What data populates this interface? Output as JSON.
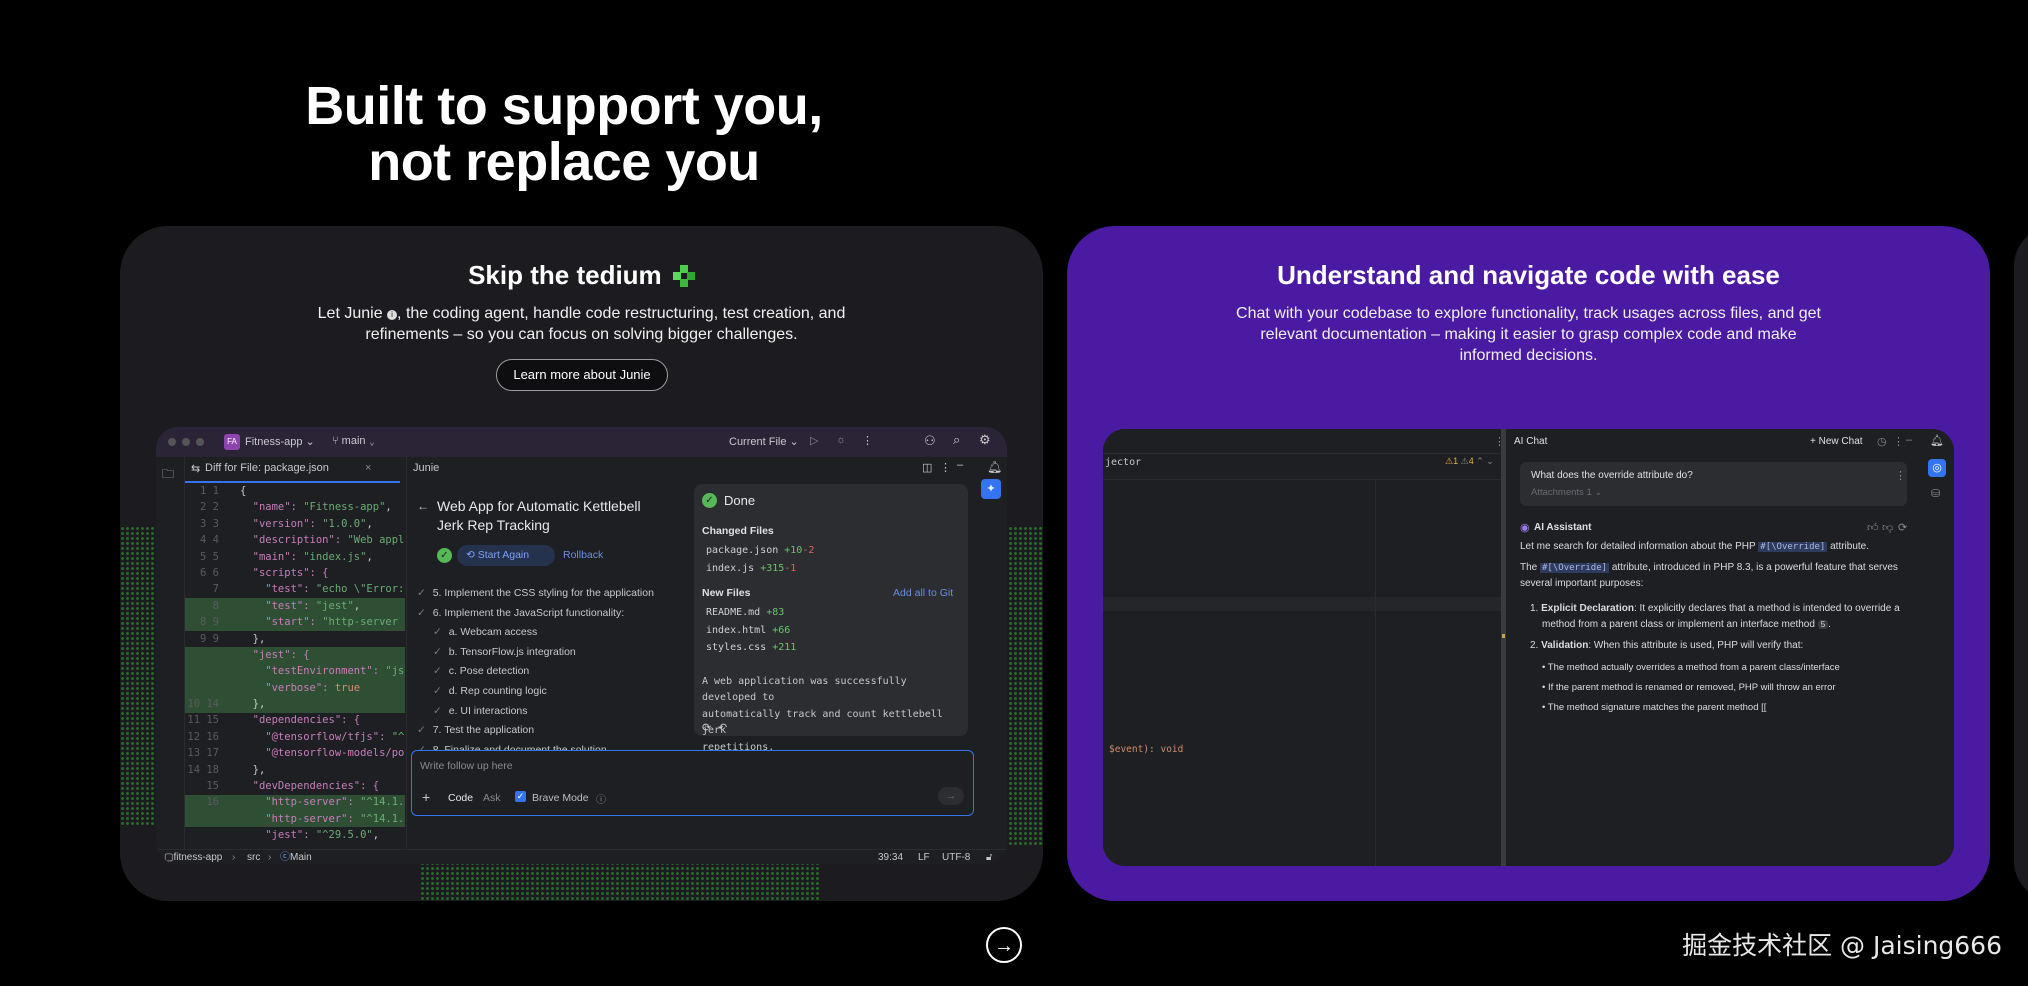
{
  "hero": {
    "line1": "Built to support you,",
    "line2": "not replace you"
  },
  "card1": {
    "title": "Skip the tedium",
    "desc_line1": "Let Junie",
    "desc_rest1": ", the coding agent, handle code restructuring, test creation, and",
    "desc_line2": "refinements – so you can focus on solving bigger challenges.",
    "cta": "Learn more about Junie",
    "ide": {
      "project_badge": "FA",
      "project": "Fitness-app",
      "branch": "main",
      "run_config": "Current File",
      "file_tab": "Diff for File: package.json",
      "panel_title": "Junie",
      "task_title_1": "Web App for Automatic Kettlebell",
      "task_title_2": "Jerk Rep Tracking",
      "start_again": "Start Again",
      "rollback": "Rollback",
      "steps": [
        "5. Implement the CSS styling for the application",
        "6. Implement the JavaScript functionality:",
        "a. Webcam access",
        "b. TensorFlow.js integration",
        "c. Pose detection",
        "d. Rep counting logic",
        "e. UI interactions",
        "7. Test the application",
        "8. Finalize and document the solution"
      ],
      "done": "Done",
      "changed_files": "Changed Files",
      "changed": [
        {
          "name": "package.json",
          "add": "+10",
          "del": "-2"
        },
        {
          "name": "index.js",
          "add": "+315",
          "del": "-1"
        }
      ],
      "new_files": "New Files",
      "add_git": "Add all to Git",
      "new": [
        {
          "name": "README.md",
          "add": "+83"
        },
        {
          "name": "index.html",
          "add": "+66"
        },
        {
          "name": "styles.css",
          "add": "+211"
        }
      ],
      "summary": [
        "A web application was successfully developed to",
        "automatically track and count kettlebell jerk",
        "repetitions."
      ],
      "input_placeholder": "Write follow up here",
      "mode_code": "Code",
      "mode_ask": "Ask",
      "brave": "Brave Mode",
      "status": {
        "project": "fitness-app",
        "src": "src",
        "main": "Main",
        "pos": "39:34",
        "lf": "LF",
        "enc": "UTF-8"
      },
      "gutter": [
        "1 1",
        "2 2",
        "3 3",
        "4 4",
        "5 5",
        "6 6",
        "7",
        "8",
        "8 9",
        "9 9",
        "",
        "",
        "",
        "10 14",
        "11 15",
        "12 16",
        "13 17",
        "14 18",
        "15",
        "16",
        ""
      ],
      "code": [
        [
          {
            "t": "{",
            "c": ""
          }
        ],
        [
          {
            "t": "  \"name\": ",
            "c": "s-key"
          },
          {
            "t": "\"Fitness-app\"",
            "c": "s-str"
          },
          {
            "t": ",",
            "c": ""
          }
        ],
        [
          {
            "t": "  \"version\": ",
            "c": "s-key"
          },
          {
            "t": "\"1.0.0\"",
            "c": "s-str"
          },
          {
            "t": ",",
            "c": ""
          }
        ],
        [
          {
            "t": "  \"description\": ",
            "c": "s-key"
          },
          {
            "t": "\"Web appl",
            "c": "s-str"
          }
        ],
        [
          {
            "t": "  \"main\": ",
            "c": "s-key"
          },
          {
            "t": "\"index.js\"",
            "c": "s-str"
          },
          {
            "t": ",",
            "c": ""
          }
        ],
        [
          {
            "t": "  \"scripts\": {",
            "c": "s-key"
          }
        ],
        [
          {
            "t": "    \"test\": ",
            "c": "s-key"
          },
          {
            "t": "\"echo \\\"Error:",
            "c": "s-str"
          }
        ],
        [
          {
            "t": "    \"test\": ",
            "c": "s-key"
          },
          {
            "t": "\"jest\"",
            "c": "s-str"
          },
          {
            "t": ",",
            "c": ""
          }
        ],
        [
          {
            "t": "    \"start\": ",
            "c": "s-key"
          },
          {
            "t": "\"http-server",
            "c": "s-str"
          }
        ],
        [
          {
            "t": "  },",
            "c": ""
          }
        ],
        [
          {
            "t": "  \"jest\": {",
            "c": "s-key"
          }
        ],
        [
          {
            "t": "    \"testEnvironment\": ",
            "c": "s-key"
          },
          {
            "t": "\"js",
            "c": "s-str"
          }
        ],
        [
          {
            "t": "    \"verbose\": ",
            "c": "s-key"
          },
          {
            "t": "true",
            "c": "s-kw"
          }
        ],
        [
          {
            "t": "  },",
            "c": ""
          }
        ],
        [
          {
            "t": "  \"dependencies\": {",
            "c": "s-key"
          }
        ],
        [
          {
            "t": "    \"@tensorflow/tfjs\": ",
            "c": "s-key"
          },
          {
            "t": "\"^",
            "c": "s-str"
          }
        ],
        [
          {
            "t": "    \"@tensorflow-models/po",
            "c": "s-key"
          }
        ],
        [
          {
            "t": "  },",
            "c": ""
          }
        ],
        [
          {
            "t": "  \"devDependencies\": {",
            "c": "s-key"
          }
        ],
        [
          {
            "t": "    \"http-server\": ",
            "c": "s-key"
          },
          {
            "t": "\"^14.1.",
            "c": "s-str"
          }
        ],
        [
          {
            "t": "    \"http-server\": ",
            "c": "s-key"
          },
          {
            "t": "\"^14.1.",
            "c": "s-str"
          }
        ],
        [
          {
            "t": "    \"jest\": ",
            "c": "s-key"
          },
          {
            "t": "\"^29.5.0\"",
            "c": "s-str"
          },
          {
            "t": ",",
            "c": ""
          }
        ]
      ]
    }
  },
  "card2": {
    "title": "Understand and navigate code with ease",
    "desc": [
      "Chat with your codebase to explore functionality, track usages across files, and get",
      "relevant documentation – making it easier to grasp complex code and make",
      "informed decisions."
    ],
    "ide": {
      "editor_tab": "jector",
      "warn1": "1",
      "warn2": "4",
      "code_line": "$event): void",
      "chat_title": "AI Chat",
      "new_chat": "New Chat",
      "question": "What does the override attribute do?",
      "attachments": "Attachments 1",
      "assistant": "AI Assistant",
      "answer_intro_a": "Let me search for detailed information about the PHP",
      "answer_intro_code": "#[\\Override]",
      "answer_intro_b": "attribute.",
      "answer_p2_a": "The",
      "answer_p2_code": "#[\\Override]",
      "answer_p2_b": "attribute, introduced in PHP 8.3, is a powerful feature that serves",
      "answer_p2_c": "several important purposes:",
      "li1_bold": "Explicit Declaration",
      "li1_text": ": It explicitly declares that a method is intended to override a",
      "li1_text2": "method from a parent class or implement an interface method",
      "li2_bold": "Validation",
      "li2_text": ": When this attribute is used, PHP will verify that:",
      "bullets": [
        "The method actually overrides a method from a parent class/interface",
        "If the parent method is renamed or removed, PHP will throw an error",
        "The method signature matches the parent method [["
      ]
    }
  },
  "watermark": "掘金技术社区 @ Jaising666",
  "next_arrow": "→"
}
